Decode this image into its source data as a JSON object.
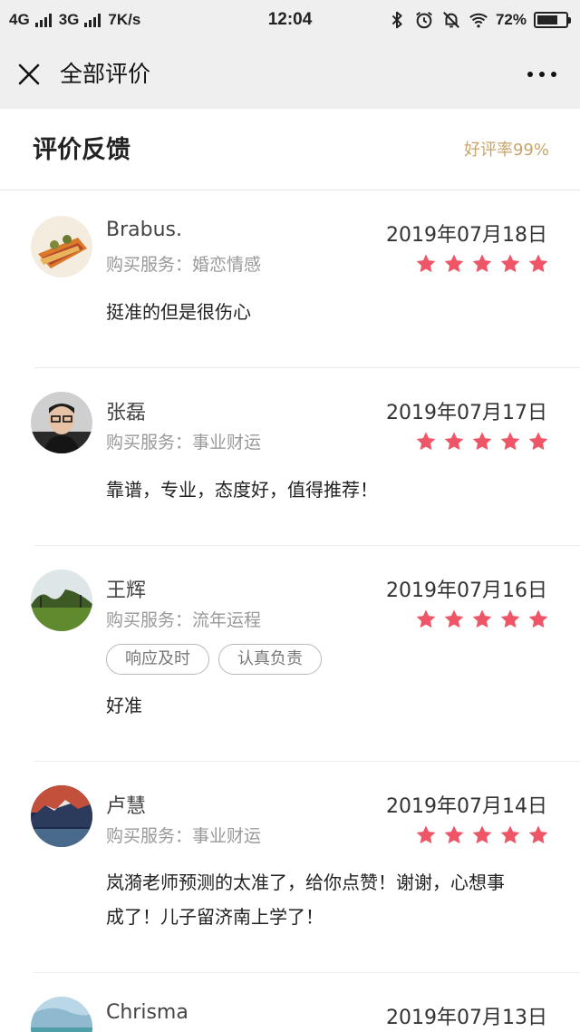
{
  "status_bar": {
    "network1": "4G",
    "network2": "3G",
    "speed": "7K/s",
    "time": "12:04",
    "battery": "72%",
    "battery_level": 0.72
  },
  "nav": {
    "title": "全部评价"
  },
  "section": {
    "title": "评价反馈",
    "rate": "好评率99%"
  },
  "colors": {
    "star": "#ee5566",
    "rate": "#c8a46a"
  },
  "reviews": [
    {
      "name": "Brabus.",
      "date": "2019年07月18日",
      "service": "购买服务：婚恋情感",
      "stars": 5,
      "text": "挺准的但是很伤心",
      "tags": []
    },
    {
      "name": "张磊",
      "date": "2019年07月17日",
      "service": "购买服务：事业财运",
      "stars": 5,
      "text": "靠谱，专业，态度好，值得推荐！",
      "tags": []
    },
    {
      "name": "王辉",
      "date": "2019年07月16日",
      "service": "购买服务：流年运程",
      "stars": 5,
      "text": "好准",
      "tags": [
        "响应及时",
        "认真负责"
      ]
    },
    {
      "name": "卢慧",
      "date": "2019年07月14日",
      "service": "购买服务：事业财运",
      "stars": 5,
      "text_line1": "岚漪老师预测的太准了，给你点赞！谢谢，心想事",
      "text_line2": "成了！儿子留济南上学了！",
      "tags": []
    },
    {
      "name": "Chrisma",
      "date": "2019年07月13日"
    }
  ]
}
